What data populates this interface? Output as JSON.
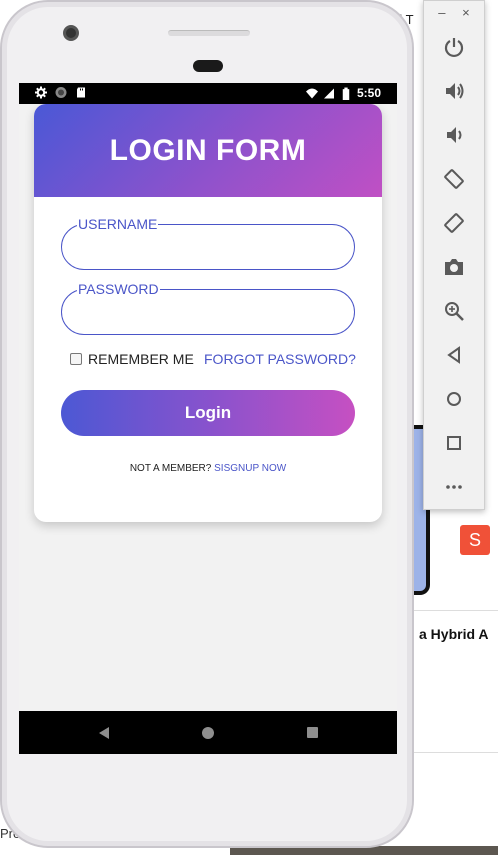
{
  "background": {
    "title_fragment": "d T",
    "caption_fragment": "a Hybrid A",
    "bottom_fragment": "Pren",
    "swift_glyph": "S"
  },
  "statusbar": {
    "time": "5:50",
    "icons": [
      "settings-icon",
      "circle-icon",
      "sd-card-icon",
      "wifi-icon",
      "signal-icon",
      "battery-icon"
    ]
  },
  "login": {
    "title": "LOGIN FORM",
    "username_label": "USERNAME",
    "username_value": "",
    "password_label": "PASSWORD",
    "password_value": "",
    "remember_label": "REMEMBER ME",
    "remember_checked": false,
    "forgot_label": "FORGOT PASSWORD?",
    "button_label": "Login",
    "signup_prompt": "NOT A MEMBER? ",
    "signup_link": "SISGNUP NOW"
  },
  "colors": {
    "accent": "#4a55c8",
    "gradient_start": "#4a58d6",
    "gradient_end": "#c050c4"
  },
  "emulator_panel": {
    "top_controls": [
      "–",
      "×"
    ],
    "tools": [
      "power-icon",
      "volume-up-icon",
      "volume-down-icon",
      "rotate-left-icon",
      "rotate-right-icon",
      "camera-icon",
      "zoom-icon",
      "back-icon",
      "home-icon",
      "overview-icon",
      "more-icon"
    ]
  }
}
